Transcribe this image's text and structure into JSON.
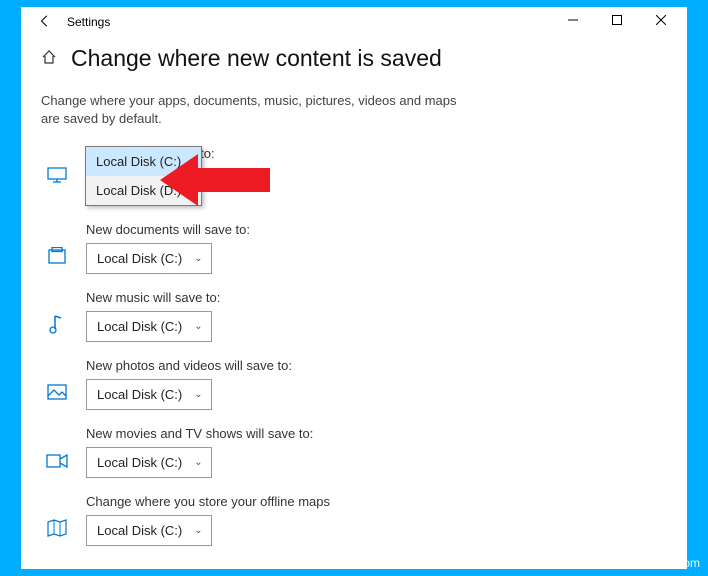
{
  "titlebar": {
    "title": "Settings"
  },
  "header": {
    "title": "Change where new content is saved"
  },
  "description": "Change where your apps, documents, music, pictures, videos and maps are saved by default.",
  "dropdown_options": [
    "Local Disk (C:)",
    "Local Disk (D:)"
  ],
  "sections": [
    {
      "label": "New apps will save to:",
      "value": "Local Disk (C:)",
      "icon": "monitor"
    },
    {
      "label": "New documents will save to:",
      "value": "Local Disk (C:)",
      "icon": "document"
    },
    {
      "label": "New music will save to:",
      "value": "Local Disk (C:)",
      "icon": "music"
    },
    {
      "label": "New photos and videos will save to:",
      "value": "Local Disk (C:)",
      "icon": "photo"
    },
    {
      "label": "New movies and TV shows will save to:",
      "value": "Local Disk (C:)",
      "icon": "video"
    },
    {
      "label": "Change where you store your offline maps",
      "value": "Local Disk (C:)",
      "icon": "map"
    }
  ],
  "watermark": "wsxdn.com",
  "colors": {
    "accent": "#0078d4",
    "arrow": "#ed1c24"
  }
}
